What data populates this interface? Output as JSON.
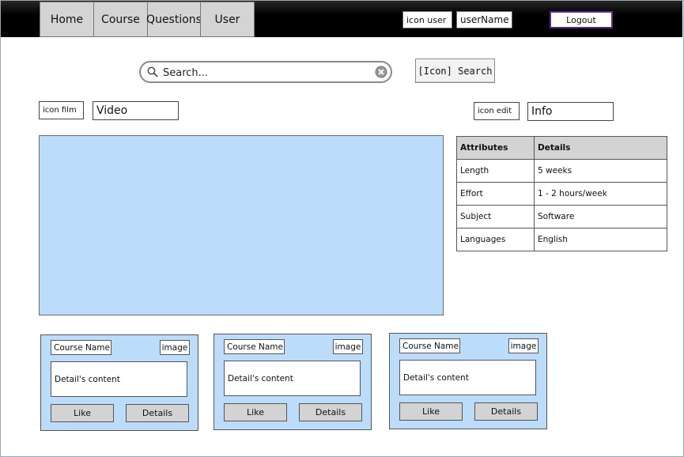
{
  "nav": {
    "tabs": [
      {
        "label": "Home"
      },
      {
        "label": "Course"
      },
      {
        "label": "Questions"
      },
      {
        "label": "User"
      }
    ],
    "icon_user_label": "icon user",
    "username": "userName",
    "logout_label": "Logout"
  },
  "search": {
    "placeholder": "Search...",
    "button_label": "[Icon] Search"
  },
  "video_section": {
    "icon_label": "icon film",
    "title": "Video"
  },
  "info_section": {
    "icon_label": "icon edit",
    "title": "Info",
    "headers": [
      "Attributes",
      "Details"
    ],
    "rows": [
      [
        "Length",
        "5 weeks"
      ],
      [
        "Effort",
        "1 - 2 hours/week"
      ],
      [
        "Subject",
        "Software"
      ],
      [
        "Languages",
        "English"
      ]
    ]
  },
  "courses": [
    {
      "name": "Course Name",
      "image": "image",
      "detail": "Detail's content",
      "like": "Like",
      "details": "Details"
    },
    {
      "name": "Course Name",
      "image": "image",
      "detail": "Detail's content",
      "like": "Like",
      "details": "Details"
    },
    {
      "name": "Course Name",
      "image": "image",
      "detail": "Detail's content",
      "like": "Like",
      "details": "Details"
    }
  ],
  "colors": {
    "topbar": "#000000",
    "video_bg": "#bcdcfb",
    "card_bg": "#bcdcfb",
    "logout_border": "#5b2a8a"
  }
}
